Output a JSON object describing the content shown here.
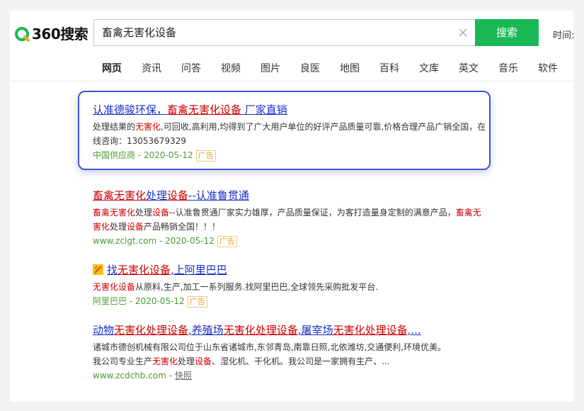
{
  "header": {
    "logo_text": "360搜索",
    "search_value": "畜禽无害化设备",
    "search_button": "搜索",
    "time_label": "时间:"
  },
  "tabs": [
    {
      "label": "网页",
      "active": true
    },
    {
      "label": "资讯"
    },
    {
      "label": "问答"
    },
    {
      "label": "视频"
    },
    {
      "label": "图片"
    },
    {
      "label": "良医"
    },
    {
      "label": "地图"
    },
    {
      "label": "百科"
    },
    {
      "label": "文库"
    },
    {
      "label": "英文"
    },
    {
      "label": "音乐"
    },
    {
      "label": "软件"
    }
  ],
  "results": [
    {
      "title_parts": [
        "认准德骏环保，",
        "畜禽无害化设备",
        " 厂家直销"
      ],
      "desc_a": "处理结果的",
      "desc_b": "无害化",
      "desc_c": ",可回收,高利用,均得到了广大用户单位的好评产品质量可靠,价格合理产品广销全国，在线咨询：13053679329",
      "source": "中国供应商",
      "date": "2020-05-12",
      "ad": "广告"
    },
    {
      "title_parts": [
        "畜禽无害化",
        "处理",
        "设备",
        "--认准鲁贯通"
      ],
      "desc_a": "畜禽无害化",
      "desc_b": "处理",
      "desc_c": "设备",
      "desc_d": "--认准鲁贯通厂家实力雄厚，产品质量保证，为客打造量身定制的满意产品，",
      "desc_e": "畜禽无害化",
      "desc_f": "处理",
      "desc_g": "设备",
      "desc_h": "产品畅销全国！！！",
      "source": "www.zclgt.com",
      "date": "2020-05-12",
      "ad": "广告"
    },
    {
      "title_parts": [
        "找",
        "无害化设备",
        ",上阿里巴巴"
      ],
      "desc_a": "无害化设备",
      "desc_b": "从原料,生产,加工一系列服务.找阿里巴巴,全球领先采购批发平台.",
      "source": "阿里巴巴",
      "date": "2020-05-12",
      "ad": "广告"
    },
    {
      "title_parts": [
        "动物",
        "无害化处理设备",
        ",养殖场",
        "无害化处理设备",
        ",屠宰场",
        "无害化处理设备",
        ",..."
      ],
      "desc_line1": "诸城市德创机械有限公司位于山东省诸城市,东邻青岛,南靠日照,北依潍坊,交通便利,环境优美。",
      "desc_a": "我公司专业生产",
      "desc_b": "无害化",
      "desc_c": "处理",
      "desc_d": "设备",
      "desc_e": "、湿化机、干化机。我公司是一家拥有生产、...",
      "source": "www.zcdchb.com",
      "sep": " - ",
      "snapshot": "快照"
    }
  ],
  "colors": {
    "accent_green": "#19b955",
    "link_blue": "#1a2fc4",
    "highlight_red": "#c00",
    "url_green": "#4a9b34",
    "ad_orange": "#e8a12a",
    "focus_border": "#3f55d8"
  },
  "icons": {
    "logo": "360-logo-icon",
    "clear": "close-icon",
    "favicon": "alibaba-favicon-icon"
  }
}
